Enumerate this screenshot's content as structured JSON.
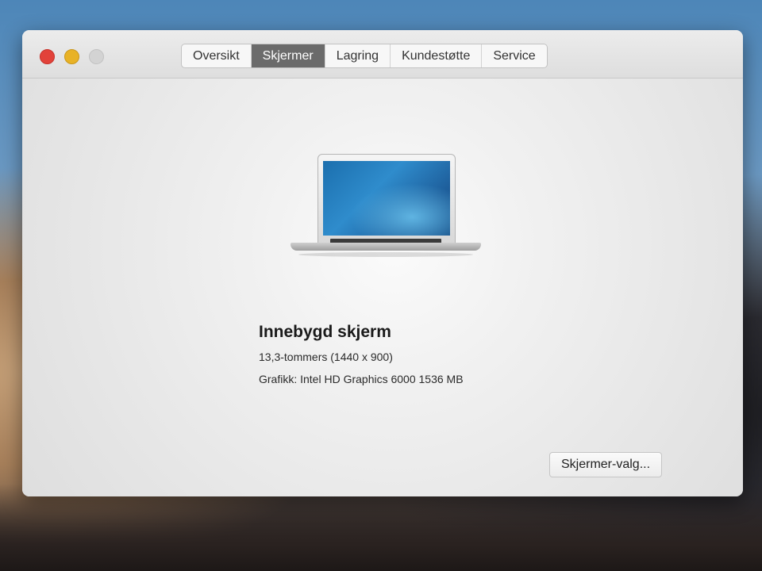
{
  "window": {
    "tabs": [
      {
        "label": "Oversikt",
        "active": false
      },
      {
        "label": "Skjermer",
        "active": true
      },
      {
        "label": "Lagring",
        "active": false
      },
      {
        "label": "Kundestøtte",
        "active": false
      },
      {
        "label": "Service",
        "active": false
      }
    ]
  },
  "display": {
    "name": "Innebygd skjerm",
    "size": "13,3-tommers (1440 x 900)",
    "graphics": "Grafikk: Intel HD Graphics 6000 1536 MB"
  },
  "buttons": {
    "display_prefs": "Skjermer-valg..."
  },
  "icons": {
    "laptop": "laptop-icon",
    "close": "close-icon",
    "minimize": "minimize-icon",
    "zoom": "zoom-icon"
  },
  "colors": {
    "close": "#e2423a",
    "minimize": "#e8b226",
    "zoom_disabled": "#d3d3d3",
    "active_tab": "#6b6b6b"
  }
}
